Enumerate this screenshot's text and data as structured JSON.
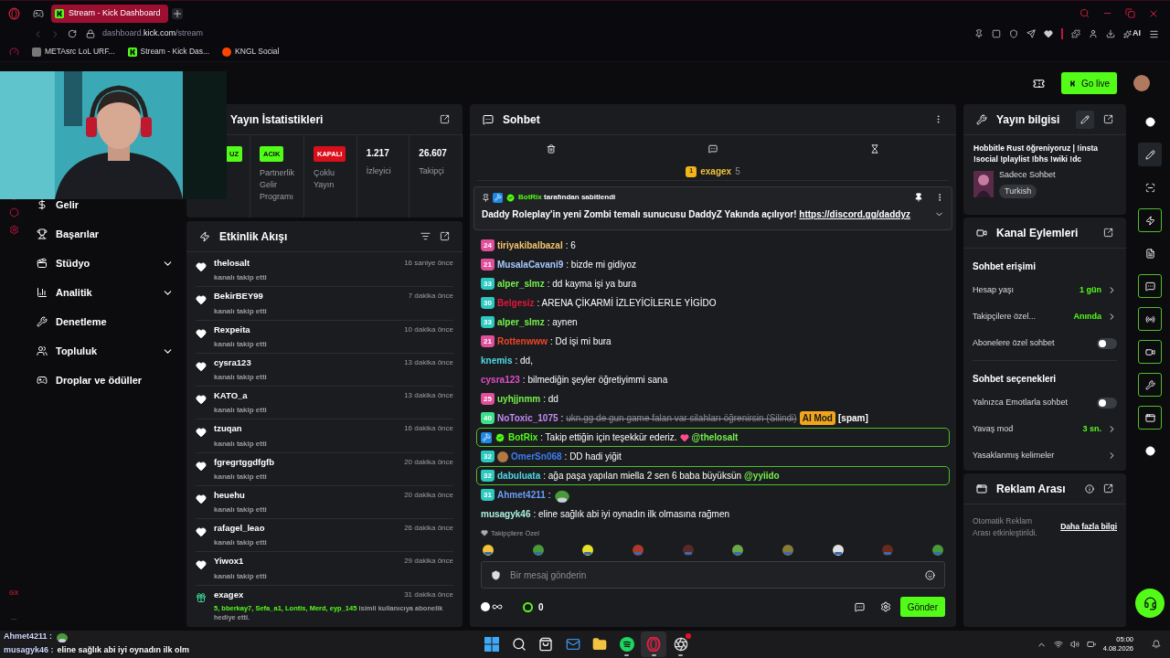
{
  "browser": {
    "tab_title": "Stream - Kick Dashboard",
    "url_host": "dashboard.",
    "url_domain": "kick.com",
    "url_path": "/stream",
    "ai_label": "AI",
    "bookmarks": [
      {
        "label": "METAsrc LoL URF...",
        "kind": "avatar"
      },
      {
        "label": "Stream - Kick Das...",
        "kind": "kick"
      },
      {
        "label": "KNGL Social",
        "kind": "reddit"
      }
    ]
  },
  "header": {
    "go_live": "Go live"
  },
  "opera_sidebar": {
    "label": "GX",
    "more": "..."
  },
  "nav": [
    {
      "label": "Gelir",
      "kind": "revenue",
      "expandable": false
    },
    {
      "label": "Başarılar",
      "kind": "trophy",
      "expandable": false
    },
    {
      "label": "Stüdyo",
      "kind": "studio",
      "expandable": true
    },
    {
      "label": "Analitik",
      "kind": "chart",
      "expandable": true
    },
    {
      "label": "Denetleme",
      "kind": "wrench",
      "expandable": false
    },
    {
      "label": "Topluluk",
      "kind": "people",
      "expandable": true
    },
    {
      "label": "Droplar ve ödüller",
      "kind": "drops",
      "expandable": false
    }
  ],
  "stats": {
    "title": "Yayın İstatistikleri",
    "items": [
      {
        "kind": "badge",
        "badge": "UZ",
        "on": true
      },
      {
        "kind": "badge",
        "badge": "ACIK",
        "on": true,
        "label": "Partnerlik Gelir Programı"
      },
      {
        "kind": "badge",
        "badge": "KAPALI",
        "on": false,
        "label": "Çoklu Yayın"
      },
      {
        "kind": "number",
        "value": "1.217",
        "label": "İzleyici"
      },
      {
        "kind": "number",
        "value": "26.607",
        "label": "Takipçi"
      }
    ]
  },
  "activity": {
    "title": "Etkinlik Akışı",
    "events": [
      {
        "kind": "follow",
        "user": "thelosalt",
        "time": "16 saniye önce",
        "text": "kanalı takip etti"
      },
      {
        "kind": "follow",
        "user": "BekirBEY99",
        "time": "7 dakika önce",
        "text": "kanalı takip etti"
      },
      {
        "kind": "follow",
        "user": "Rexpeita",
        "time": "10 dakika önce",
        "text": "kanalı takip etti"
      },
      {
        "kind": "follow",
        "user": "cysra123",
        "time": "13 dakika önce",
        "text": "kanalı takip etti"
      },
      {
        "kind": "follow",
        "user": "KATO_a",
        "time": "13 dakika önce",
        "text": "kanalı takip etti"
      },
      {
        "kind": "follow",
        "user": "tzuqan",
        "time": "16 dakika önce",
        "text": "kanalı takip etti"
      },
      {
        "kind": "follow",
        "user": "fgregrtggdfgfb",
        "time": "20 dakika önce",
        "text": "kanalı takip etti"
      },
      {
        "kind": "follow",
        "user": "heuehu",
        "time": "20 dakika önce",
        "text": "kanalı takip etti"
      },
      {
        "kind": "follow",
        "user": "rafagel_leao",
        "time": "26 dakika önce",
        "text": "kanalı takip etti"
      },
      {
        "kind": "follow",
        "user": "Yiwox1",
        "time": "29 dakika önce",
        "text": "kanalı takip etti"
      },
      {
        "kind": "gift",
        "user": "exagex",
        "time": "31 dakika önce",
        "names": "5, bberkay7, Sefa_a1, Lontis, Merd, eyp_145",
        "text": "isimli kullanıcıya abonelik hediye etti."
      }
    ]
  },
  "chat": {
    "title": "Sohbet",
    "leader": {
      "rank": "1",
      "user": "exagex",
      "count": "5"
    },
    "pinned": {
      "by": "BotRix",
      "by_text": "tarafından sabitlendi",
      "text": "Daddy Roleplay'in yeni Zombi temalı sunucusu DaddyZ Yakında açılıyor!",
      "link": "https://discord.gg/daddyz"
    },
    "messages": [
      {
        "kind": "text",
        "badges": [
          {
            "kind": "sub",
            "text": "24",
            "color": "#e0509a"
          }
        ],
        "user": "tiriyakibalbazal",
        "color": "#f7c56b",
        "text": ": 6",
        "highlighted": false,
        "heart": false
      },
      {
        "kind": "text",
        "badges": [
          {
            "kind": "sub",
            "text": "21",
            "color": "#e0509a"
          }
        ],
        "user": "MusalaCavani9",
        "color": "#a6c8ff",
        "text": ": bizde mi gidiyoz",
        "highlighted": false,
        "heart": false
      },
      {
        "kind": "text",
        "badges": [
          {
            "kind": "sub",
            "text": "33",
            "color": "#2cc9c0"
          }
        ],
        "user": "alper_slmz",
        "color": "#75f04c",
        "text": ": dd kayma işi ya bura",
        "highlighted": false,
        "heart": false
      },
      {
        "kind": "text",
        "badges": [
          {
            "kind": "sub",
            "text": "30",
            "color": "#2cc9c0"
          }
        ],
        "user": "Belgesiz",
        "color": "#e3173d",
        "text": ": ARENA ÇİKARMİ İZLEYİCİLERLE YİGİDO",
        "highlighted": false,
        "heart": false
      },
      {
        "kind": "text",
        "badges": [
          {
            "kind": "sub",
            "text": "33",
            "color": "#2cc9c0"
          }
        ],
        "user": "alper_slmz",
        "color": "#75f04c",
        "text": ": aynen",
        "highlighted": false,
        "heart": false
      },
      {
        "kind": "text",
        "badges": [
          {
            "kind": "sub",
            "text": "21",
            "color": "#e0509a"
          }
        ],
        "user": "Rottenwww",
        "color": "#f0452a",
        "text": ": Dd işi mi bura",
        "highlighted": false,
        "heart": false
      },
      {
        "kind": "text",
        "user": "knemis",
        "color": "#4fd8e8",
        "text": ": dd,",
        "highlighted": false,
        "heart": false
      },
      {
        "kind": "text",
        "user": "cysra123",
        "color": "#e04fc8",
        "text": ": bilmediğin şeyler öğretiyimmi sana",
        "highlighted": false,
        "heart": false
      },
      {
        "kind": "text",
        "badges": [
          {
            "kind": "sub",
            "text": "25",
            "color": "#e0509a"
          }
        ],
        "user": "uyhjjnmm",
        "color": "#75f04c",
        "text": ": dd",
        "highlighted": false,
        "heart": false
      },
      {
        "kind": "deleted",
        "badges": [
          {
            "kind": "sub",
            "text": "40",
            "color": "#3ee08a"
          }
        ],
        "user": "NoToxic_1075",
        "color": "#c28af0",
        "text": ":",
        "struck": "ukn.gg de gun game falan var silahları öğrenirsin (Silindi)",
        "tag": "AI Mod",
        "note": "[spam]",
        "highlighted": false,
        "heart": false
      },
      {
        "kind": "text",
        "badges": [
          {
            "kind": "mod"
          },
          {
            "kind": "verified"
          }
        ],
        "user": "BotRix",
        "color": "#53fc18",
        "text": ": Takip ettiğin için teşekkür ederiz.",
        "mention": "@thelosalt",
        "highlighted": true,
        "heart": true
      },
      {
        "kind": "text",
        "badges": [
          {
            "kind": "sub",
            "text": "32",
            "color": "#2cc9c0"
          },
          {
            "kind": "avatar"
          }
        ],
        "user": "OmerSn068",
        "color": "#3b7ef0",
        "text": ": DD hadi yiğit",
        "highlighted": false,
        "heart": false
      },
      {
        "kind": "text",
        "badges": [
          {
            "kind": "sub",
            "text": "32",
            "color": "#2cc9c0"
          }
        ],
        "user": "dabuluata",
        "color": "#4fd8e8",
        "text": ": ağa paşa yapılan miella 2 sen 6 baba büyüksün",
        "mention": "@yyiido",
        "highlighted": true,
        "heart": false
      },
      {
        "kind": "emote",
        "badges": [
          {
            "kind": "sub",
            "text": "31",
            "color": "#2cc9c0"
          }
        ],
        "user": "Ahmet4211",
        "color": "#6b9cf5",
        "text": ":",
        "highlighted": false,
        "heart": false
      },
      {
        "kind": "text",
        "user": "musagyk46",
        "color": "#a8f0d8",
        "text": ": eline sağlık abi iyi oynadın ilk olmasına rağmen",
        "highlighted": false,
        "heart": false
      }
    ],
    "emotes_label": "Takipçilere Özel",
    "input_placeholder": "Bir mesaj gönderin",
    "kicks": "0",
    "send": "Gönder"
  },
  "stream_info": {
    "title": "Yayın bilgisi",
    "stream_title": "Hobbitle Rust öğreniyoruz | !insta !social !playlist !bhs !wiki !dc",
    "category": "Sadece Sohbet",
    "language": "Turkish"
  },
  "actions": {
    "title": "Kanal Eylemleri",
    "sections": [
      {
        "title": "Sohbet erişimi",
        "rows": [
          {
            "kind": "link",
            "label": "Hesap yaşı",
            "value": "1 gün"
          },
          {
            "kind": "link",
            "label": "Takipçilere özel...",
            "value": "Anında"
          },
          {
            "kind": "toggle",
            "label": "Abonelere özel sohbet",
            "on": false
          }
        ]
      },
      {
        "title": "Sohbet seçenekleri",
        "rows": [
          {
            "kind": "toggle",
            "label": "Yalnızca Emotlarla sohbet",
            "on": false
          },
          {
            "kind": "link",
            "label": "Yavaş mod",
            "value": "3 sn."
          },
          {
            "kind": "link",
            "label": "Yasaklanmış kelimeler"
          }
        ]
      }
    ]
  },
  "ads": {
    "title": "Reklam Arası",
    "text": "Otomatik Reklam Arası etkinleştirildi.",
    "link": "Daha fazla bilgi"
  },
  "rail": [
    {
      "kind": "info",
      "on": false,
      "selected": false
    },
    {
      "kind": "edit",
      "on": false,
      "selected": true
    },
    {
      "kind": "focus",
      "on": false,
      "selected": false
    },
    {
      "kind": "activity",
      "on": true,
      "selected": false
    },
    {
      "kind": "notes",
      "on": false,
      "selected": false
    },
    {
      "kind": "chat",
      "on": true,
      "selected": false
    },
    {
      "kind": "broadcast",
      "on": true,
      "selected": false
    },
    {
      "kind": "camera",
      "on": true,
      "selected": false
    },
    {
      "kind": "wrench",
      "on": true,
      "selected": false
    },
    {
      "kind": "window",
      "on": true,
      "selected": false
    },
    {
      "kind": "dots",
      "on": false,
      "selected": false
    }
  ],
  "overlay": [
    {
      "kind": "emote",
      "user": "Ahmet4211 :"
    },
    {
      "kind": "text",
      "user": "musagyk46 :",
      "text": "eline sağlık abi iyi oynadın ilk olm"
    }
  ],
  "taskbar": {
    "apps": [
      {
        "kind": "start",
        "running": false,
        "selected": false,
        "alert": false
      },
      {
        "kind": "search",
        "running": false,
        "selected": false,
        "alert": false
      },
      {
        "kind": "store",
        "running": false,
        "selected": false,
        "alert": false
      },
      {
        "kind": "mail",
        "running": false,
        "selected": false,
        "alert": false
      },
      {
        "kind": "files",
        "running": false,
        "selected": false,
        "alert": false
      },
      {
        "kind": "spotify",
        "running": true,
        "selected": false,
        "alert": false
      },
      {
        "kind": "opera",
        "running": true,
        "selected": true,
        "alert": false
      },
      {
        "kind": "obs",
        "running": true,
        "selected": false,
        "alert": true
      }
    ],
    "time": "05:00",
    "date": "4.08.2026"
  }
}
